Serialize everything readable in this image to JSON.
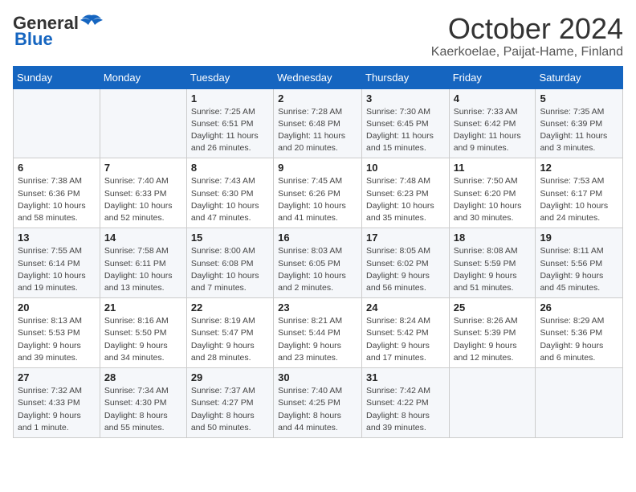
{
  "logo": {
    "line1": "General",
    "line2": "Blue"
  },
  "title": "October 2024",
  "subtitle": "Kaerkoelae, Paijat-Hame, Finland",
  "weekdays": [
    "Sunday",
    "Monday",
    "Tuesday",
    "Wednesday",
    "Thursday",
    "Friday",
    "Saturday"
  ],
  "weeks": [
    [
      {
        "day": "",
        "sunrise": "",
        "sunset": "",
        "daylight": ""
      },
      {
        "day": "",
        "sunrise": "",
        "sunset": "",
        "daylight": ""
      },
      {
        "day": "1",
        "sunrise": "Sunrise: 7:25 AM",
        "sunset": "Sunset: 6:51 PM",
        "daylight": "Daylight: 11 hours and 26 minutes."
      },
      {
        "day": "2",
        "sunrise": "Sunrise: 7:28 AM",
        "sunset": "Sunset: 6:48 PM",
        "daylight": "Daylight: 11 hours and 20 minutes."
      },
      {
        "day": "3",
        "sunrise": "Sunrise: 7:30 AM",
        "sunset": "Sunset: 6:45 PM",
        "daylight": "Daylight: 11 hours and 15 minutes."
      },
      {
        "day": "4",
        "sunrise": "Sunrise: 7:33 AM",
        "sunset": "Sunset: 6:42 PM",
        "daylight": "Daylight: 11 hours and 9 minutes."
      },
      {
        "day": "5",
        "sunrise": "Sunrise: 7:35 AM",
        "sunset": "Sunset: 6:39 PM",
        "daylight": "Daylight: 11 hours and 3 minutes."
      }
    ],
    [
      {
        "day": "6",
        "sunrise": "Sunrise: 7:38 AM",
        "sunset": "Sunset: 6:36 PM",
        "daylight": "Daylight: 10 hours and 58 minutes."
      },
      {
        "day": "7",
        "sunrise": "Sunrise: 7:40 AM",
        "sunset": "Sunset: 6:33 PM",
        "daylight": "Daylight: 10 hours and 52 minutes."
      },
      {
        "day": "8",
        "sunrise": "Sunrise: 7:43 AM",
        "sunset": "Sunset: 6:30 PM",
        "daylight": "Daylight: 10 hours and 47 minutes."
      },
      {
        "day": "9",
        "sunrise": "Sunrise: 7:45 AM",
        "sunset": "Sunset: 6:26 PM",
        "daylight": "Daylight: 10 hours and 41 minutes."
      },
      {
        "day": "10",
        "sunrise": "Sunrise: 7:48 AM",
        "sunset": "Sunset: 6:23 PM",
        "daylight": "Daylight: 10 hours and 35 minutes."
      },
      {
        "day": "11",
        "sunrise": "Sunrise: 7:50 AM",
        "sunset": "Sunset: 6:20 PM",
        "daylight": "Daylight: 10 hours and 30 minutes."
      },
      {
        "day": "12",
        "sunrise": "Sunrise: 7:53 AM",
        "sunset": "Sunset: 6:17 PM",
        "daylight": "Daylight: 10 hours and 24 minutes."
      }
    ],
    [
      {
        "day": "13",
        "sunrise": "Sunrise: 7:55 AM",
        "sunset": "Sunset: 6:14 PM",
        "daylight": "Daylight: 10 hours and 19 minutes."
      },
      {
        "day": "14",
        "sunrise": "Sunrise: 7:58 AM",
        "sunset": "Sunset: 6:11 PM",
        "daylight": "Daylight: 10 hours and 13 minutes."
      },
      {
        "day": "15",
        "sunrise": "Sunrise: 8:00 AM",
        "sunset": "Sunset: 6:08 PM",
        "daylight": "Daylight: 10 hours and 7 minutes."
      },
      {
        "day": "16",
        "sunrise": "Sunrise: 8:03 AM",
        "sunset": "Sunset: 6:05 PM",
        "daylight": "Daylight: 10 hours and 2 minutes."
      },
      {
        "day": "17",
        "sunrise": "Sunrise: 8:05 AM",
        "sunset": "Sunset: 6:02 PM",
        "daylight": "Daylight: 9 hours and 56 minutes."
      },
      {
        "day": "18",
        "sunrise": "Sunrise: 8:08 AM",
        "sunset": "Sunset: 5:59 PM",
        "daylight": "Daylight: 9 hours and 51 minutes."
      },
      {
        "day": "19",
        "sunrise": "Sunrise: 8:11 AM",
        "sunset": "Sunset: 5:56 PM",
        "daylight": "Daylight: 9 hours and 45 minutes."
      }
    ],
    [
      {
        "day": "20",
        "sunrise": "Sunrise: 8:13 AM",
        "sunset": "Sunset: 5:53 PM",
        "daylight": "Daylight: 9 hours and 39 minutes."
      },
      {
        "day": "21",
        "sunrise": "Sunrise: 8:16 AM",
        "sunset": "Sunset: 5:50 PM",
        "daylight": "Daylight: 9 hours and 34 minutes."
      },
      {
        "day": "22",
        "sunrise": "Sunrise: 8:19 AM",
        "sunset": "Sunset: 5:47 PM",
        "daylight": "Daylight: 9 hours and 28 minutes."
      },
      {
        "day": "23",
        "sunrise": "Sunrise: 8:21 AM",
        "sunset": "Sunset: 5:44 PM",
        "daylight": "Daylight: 9 hours and 23 minutes."
      },
      {
        "day": "24",
        "sunrise": "Sunrise: 8:24 AM",
        "sunset": "Sunset: 5:42 PM",
        "daylight": "Daylight: 9 hours and 17 minutes."
      },
      {
        "day": "25",
        "sunrise": "Sunrise: 8:26 AM",
        "sunset": "Sunset: 5:39 PM",
        "daylight": "Daylight: 9 hours and 12 minutes."
      },
      {
        "day": "26",
        "sunrise": "Sunrise: 8:29 AM",
        "sunset": "Sunset: 5:36 PM",
        "daylight": "Daylight: 9 hours and 6 minutes."
      }
    ],
    [
      {
        "day": "27",
        "sunrise": "Sunrise: 7:32 AM",
        "sunset": "Sunset: 4:33 PM",
        "daylight": "Daylight: 9 hours and 1 minute."
      },
      {
        "day": "28",
        "sunrise": "Sunrise: 7:34 AM",
        "sunset": "Sunset: 4:30 PM",
        "daylight": "Daylight: 8 hours and 55 minutes."
      },
      {
        "day": "29",
        "sunrise": "Sunrise: 7:37 AM",
        "sunset": "Sunset: 4:27 PM",
        "daylight": "Daylight: 8 hours and 50 minutes."
      },
      {
        "day": "30",
        "sunrise": "Sunrise: 7:40 AM",
        "sunset": "Sunset: 4:25 PM",
        "daylight": "Daylight: 8 hours and 44 minutes."
      },
      {
        "day": "31",
        "sunrise": "Sunrise: 7:42 AM",
        "sunset": "Sunset: 4:22 PM",
        "daylight": "Daylight: 8 hours and 39 minutes."
      },
      {
        "day": "",
        "sunrise": "",
        "sunset": "",
        "daylight": ""
      },
      {
        "day": "",
        "sunrise": "",
        "sunset": "",
        "daylight": ""
      }
    ]
  ]
}
